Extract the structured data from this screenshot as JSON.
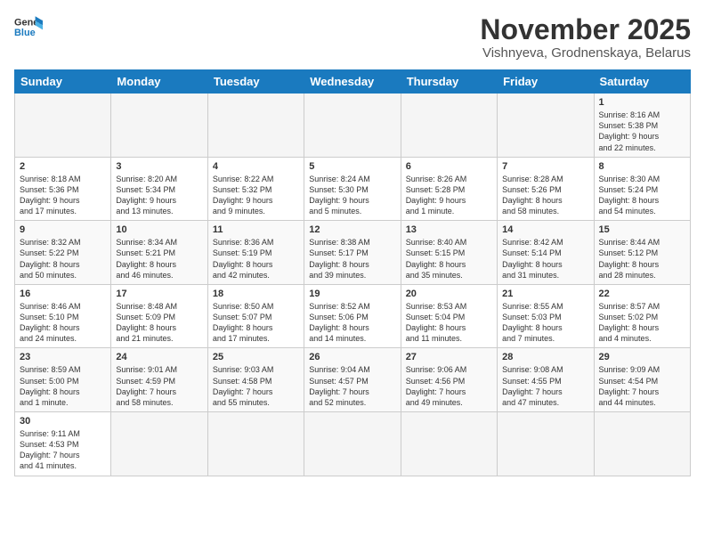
{
  "header": {
    "logo": {
      "general": "General",
      "blue": "Blue"
    },
    "title": "November 2025",
    "location": "Vishnyeva, Grodnenskaya, Belarus"
  },
  "weekdays": [
    "Sunday",
    "Monday",
    "Tuesday",
    "Wednesday",
    "Thursday",
    "Friday",
    "Saturday"
  ],
  "weeks": [
    [
      {
        "day": "",
        "info": ""
      },
      {
        "day": "",
        "info": ""
      },
      {
        "day": "",
        "info": ""
      },
      {
        "day": "",
        "info": ""
      },
      {
        "day": "",
        "info": ""
      },
      {
        "day": "",
        "info": ""
      },
      {
        "day": "1",
        "info": "Sunrise: 8:16 AM\nSunset: 5:38 PM\nDaylight: 9 hours\nand 22 minutes."
      }
    ],
    [
      {
        "day": "2",
        "info": "Sunrise: 8:18 AM\nSunset: 5:36 PM\nDaylight: 9 hours\nand 17 minutes."
      },
      {
        "day": "3",
        "info": "Sunrise: 8:20 AM\nSunset: 5:34 PM\nDaylight: 9 hours\nand 13 minutes."
      },
      {
        "day": "4",
        "info": "Sunrise: 8:22 AM\nSunset: 5:32 PM\nDaylight: 9 hours\nand 9 minutes."
      },
      {
        "day": "5",
        "info": "Sunrise: 8:24 AM\nSunset: 5:30 PM\nDaylight: 9 hours\nand 5 minutes."
      },
      {
        "day": "6",
        "info": "Sunrise: 8:26 AM\nSunset: 5:28 PM\nDaylight: 9 hours\nand 1 minute."
      },
      {
        "day": "7",
        "info": "Sunrise: 8:28 AM\nSunset: 5:26 PM\nDaylight: 8 hours\nand 58 minutes."
      },
      {
        "day": "8",
        "info": "Sunrise: 8:30 AM\nSunset: 5:24 PM\nDaylight: 8 hours\nand 54 minutes."
      }
    ],
    [
      {
        "day": "9",
        "info": "Sunrise: 8:32 AM\nSunset: 5:22 PM\nDaylight: 8 hours\nand 50 minutes."
      },
      {
        "day": "10",
        "info": "Sunrise: 8:34 AM\nSunset: 5:21 PM\nDaylight: 8 hours\nand 46 minutes."
      },
      {
        "day": "11",
        "info": "Sunrise: 8:36 AM\nSunset: 5:19 PM\nDaylight: 8 hours\nand 42 minutes."
      },
      {
        "day": "12",
        "info": "Sunrise: 8:38 AM\nSunset: 5:17 PM\nDaylight: 8 hours\nand 39 minutes."
      },
      {
        "day": "13",
        "info": "Sunrise: 8:40 AM\nSunset: 5:15 PM\nDaylight: 8 hours\nand 35 minutes."
      },
      {
        "day": "14",
        "info": "Sunrise: 8:42 AM\nSunset: 5:14 PM\nDaylight: 8 hours\nand 31 minutes."
      },
      {
        "day": "15",
        "info": "Sunrise: 8:44 AM\nSunset: 5:12 PM\nDaylight: 8 hours\nand 28 minutes."
      }
    ],
    [
      {
        "day": "16",
        "info": "Sunrise: 8:46 AM\nSunset: 5:10 PM\nDaylight: 8 hours\nand 24 minutes."
      },
      {
        "day": "17",
        "info": "Sunrise: 8:48 AM\nSunset: 5:09 PM\nDaylight: 8 hours\nand 21 minutes."
      },
      {
        "day": "18",
        "info": "Sunrise: 8:50 AM\nSunset: 5:07 PM\nDaylight: 8 hours\nand 17 minutes."
      },
      {
        "day": "19",
        "info": "Sunrise: 8:52 AM\nSunset: 5:06 PM\nDaylight: 8 hours\nand 14 minutes."
      },
      {
        "day": "20",
        "info": "Sunrise: 8:53 AM\nSunset: 5:04 PM\nDaylight: 8 hours\nand 11 minutes."
      },
      {
        "day": "21",
        "info": "Sunrise: 8:55 AM\nSunset: 5:03 PM\nDaylight: 8 hours\nand 7 minutes."
      },
      {
        "day": "22",
        "info": "Sunrise: 8:57 AM\nSunset: 5:02 PM\nDaylight: 8 hours\nand 4 minutes."
      }
    ],
    [
      {
        "day": "23",
        "info": "Sunrise: 8:59 AM\nSunset: 5:00 PM\nDaylight: 8 hours\nand 1 minute."
      },
      {
        "day": "24",
        "info": "Sunrise: 9:01 AM\nSunset: 4:59 PM\nDaylight: 7 hours\nand 58 minutes."
      },
      {
        "day": "25",
        "info": "Sunrise: 9:03 AM\nSunset: 4:58 PM\nDaylight: 7 hours\nand 55 minutes."
      },
      {
        "day": "26",
        "info": "Sunrise: 9:04 AM\nSunset: 4:57 PM\nDaylight: 7 hours\nand 52 minutes."
      },
      {
        "day": "27",
        "info": "Sunrise: 9:06 AM\nSunset: 4:56 PM\nDaylight: 7 hours\nand 49 minutes."
      },
      {
        "day": "28",
        "info": "Sunrise: 9:08 AM\nSunset: 4:55 PM\nDaylight: 7 hours\nand 47 minutes."
      },
      {
        "day": "29",
        "info": "Sunrise: 9:09 AM\nSunset: 4:54 PM\nDaylight: 7 hours\nand 44 minutes."
      }
    ],
    [
      {
        "day": "30",
        "info": "Sunrise: 9:11 AM\nSunset: 4:53 PM\nDaylight: 7 hours\nand 41 minutes."
      },
      {
        "day": "",
        "info": ""
      },
      {
        "day": "",
        "info": ""
      },
      {
        "day": "",
        "info": ""
      },
      {
        "day": "",
        "info": ""
      },
      {
        "day": "",
        "info": ""
      },
      {
        "day": "",
        "info": ""
      }
    ]
  ]
}
